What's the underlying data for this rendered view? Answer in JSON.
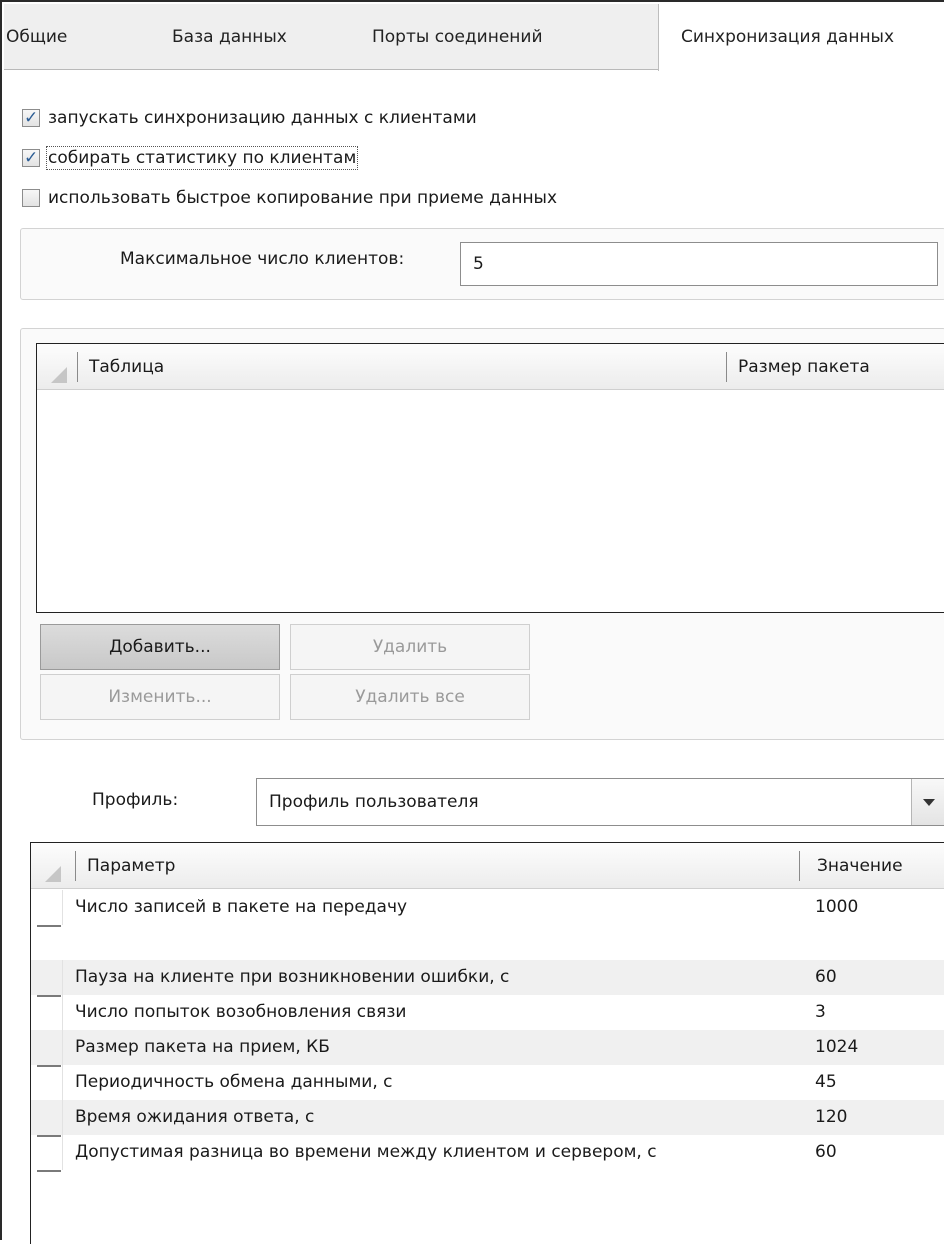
{
  "tabs": [
    {
      "label": "Общие"
    },
    {
      "label": "База данных"
    },
    {
      "label": "Порты соединений"
    },
    {
      "label": "Синхронизация данных",
      "active": true
    }
  ],
  "options": {
    "run_sync": {
      "label": "запускать синхронизацию данных с клиентами",
      "checked": true
    },
    "collect_stats": {
      "label": "собирать статистику по клиентам",
      "checked": true
    },
    "fast_copy": {
      "label": "использовать быстрое копирование при приеме данных",
      "checked": false
    }
  },
  "max_clients": {
    "label": "Максимальное число клиентов:",
    "value": "5"
  },
  "tables_grid": {
    "columns": [
      "Таблица",
      "Размер пакета"
    ],
    "rows": []
  },
  "buttons": {
    "add": "Добавить...",
    "remove": "Удалить",
    "edit": "Изменить...",
    "remove_all": "Удалить все"
  },
  "profile": {
    "label": "Профиль:",
    "value": "Профиль пользователя"
  },
  "params_grid": {
    "columns": [
      "Параметр",
      "Значение"
    ],
    "rows": [
      {
        "name": "Число записей в пакете на передачу",
        "value": "1000"
      },
      {
        "name": "Пауза на клиенте при возникновении ошибки, с",
        "value": "60"
      },
      {
        "name": "Число попыток возобновления связи",
        "value": "3"
      },
      {
        "name": "Размер пакета на прием, КБ",
        "value": "1024"
      },
      {
        "name": "Периодичность обмена данными, с",
        "value": "45"
      },
      {
        "name": "Время ожидания ответа, с",
        "value": "120"
      },
      {
        "name": "Допустимая разница во времени между клиентом и сервером, с",
        "value": "60"
      }
    ]
  },
  "colors": {
    "check_mark": "#2c5d94",
    "panel_bg": "#efefef",
    "alt_row": "#f0f0f0"
  }
}
